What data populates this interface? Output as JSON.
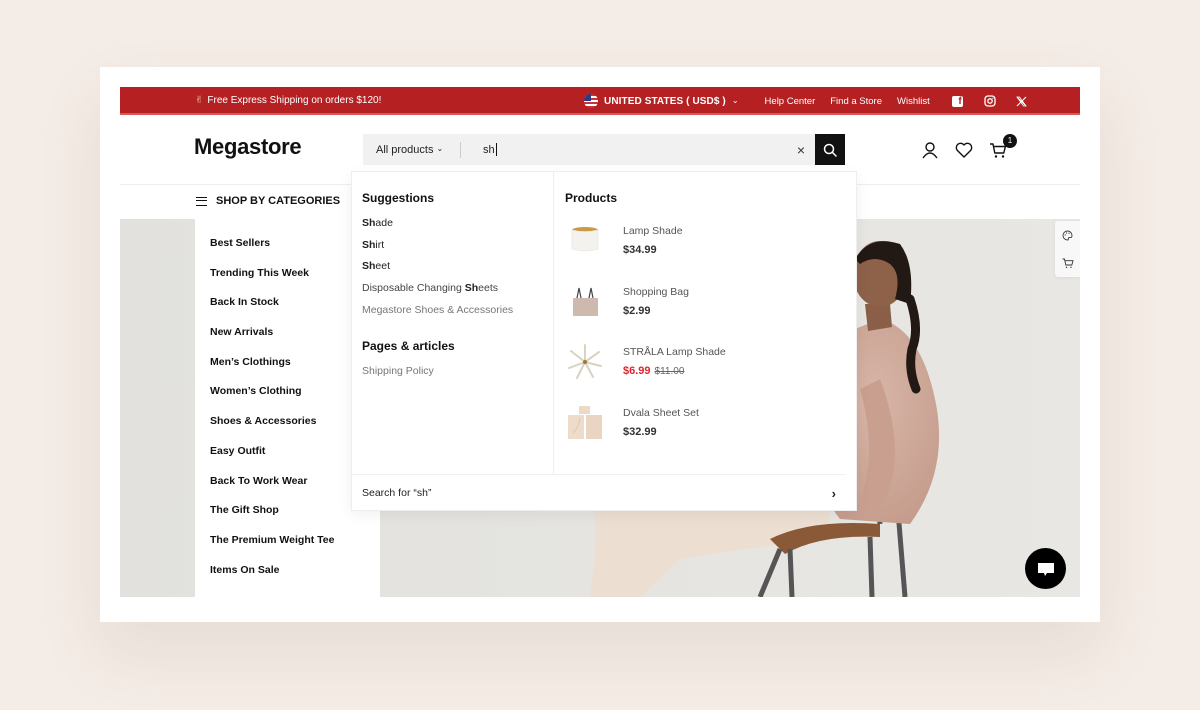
{
  "announcement": {
    "emoji": "✌",
    "text": "Free Express Shipping on orders $120!"
  },
  "topbar": {
    "country": "UNITED STATES ( USD$ )",
    "links": [
      "Help Center",
      "Find a Store",
      "Wishlist"
    ],
    "social": [
      "facebook",
      "instagram",
      "x"
    ]
  },
  "header": {
    "logo": "Megastore",
    "search": {
      "scope": "All products",
      "query": "sh",
      "clear_icon": "×"
    },
    "cart_count": "1"
  },
  "nav": {
    "categories_label": "SHOP BY CATEGORIES"
  },
  "categories": [
    "Best Sellers",
    "Trending This Week",
    "Back In Stock",
    "New Arrivals",
    "Men’s Clothings",
    "Women’s Clothing",
    "Shoes & Accessories",
    "Easy Outfit",
    "Back To Work Wear",
    "The Gift Shop",
    "The Premium Weight Tee",
    "Items On Sale"
  ],
  "dropdown": {
    "suggestions_title": "Suggestions",
    "suggestions": [
      {
        "pre": "",
        "match": "Sh",
        "post": "ade"
      },
      {
        "pre": "",
        "match": "Sh",
        "post": "irt"
      },
      {
        "pre": "",
        "match": "Sh",
        "post": "eet"
      },
      {
        "pre": "Disposable Changing ",
        "match": "Sh",
        "post": "eets"
      },
      {
        "pre": "Megastore Shoes & Accessories",
        "match": "",
        "post": ""
      }
    ],
    "pages_title": "Pages & articles",
    "pages": [
      "Shipping Policy"
    ],
    "products_title": "Products",
    "products": [
      {
        "name": "Lamp Shade",
        "price": "$34.99",
        "old_price": "",
        "on_sale": false
      },
      {
        "name": "Shopping Bag",
        "price": "$2.99",
        "old_price": "",
        "on_sale": false
      },
      {
        "name": "STRÅLA Lamp Shade",
        "price": "$6.99",
        "old_price": "$11.00",
        "on_sale": true
      },
      {
        "name": "Dvala Sheet Set",
        "price": "$32.99",
        "old_price": "",
        "on_sale": false
      }
    ],
    "search_for": "Search for “sh”",
    "chevron": "›"
  },
  "colors": {
    "brand_red": "#b52123",
    "sale_red": "#e0262e",
    "page_bg": "#f4ece6"
  }
}
